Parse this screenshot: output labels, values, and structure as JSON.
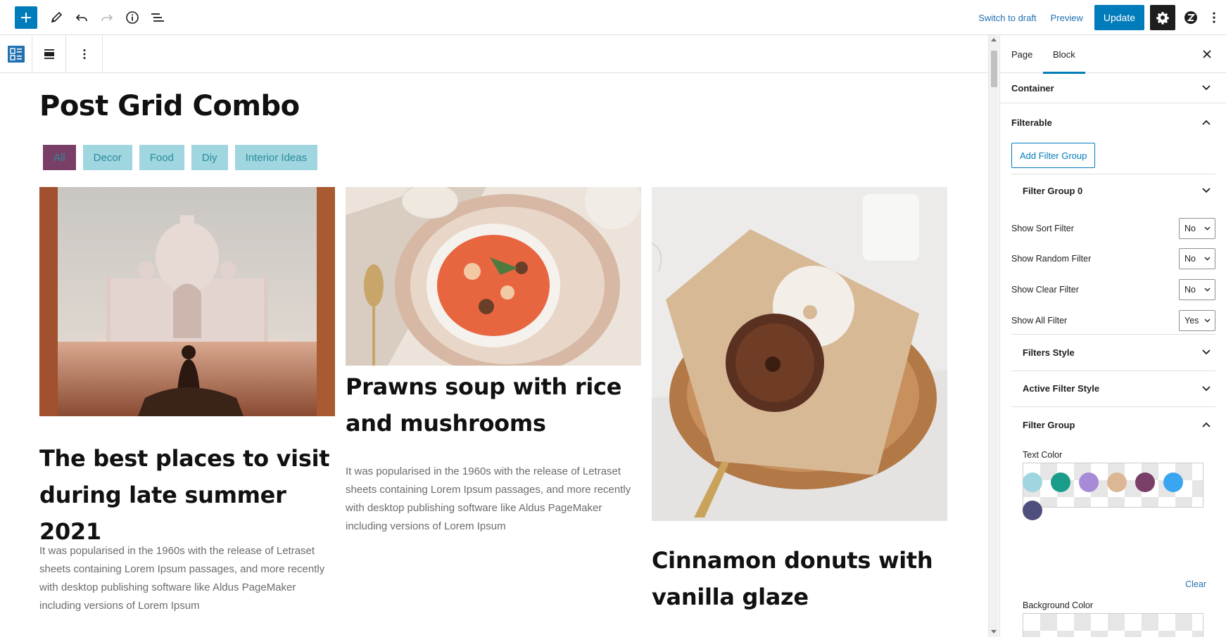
{
  "toolbar": {
    "switch_to_draft": "Switch to draft",
    "preview": "Preview",
    "update": "Update"
  },
  "page": {
    "title": "Post Grid Combo",
    "filters": [
      "All",
      "Decor",
      "Food",
      "Diy",
      "Interior Ideas"
    ],
    "active_filter": "All"
  },
  "posts": [
    {
      "title": "The best places to visit during late summer 2021",
      "excerpt": "It was popularised in the 1960s with the release of Letraset sheets containing Lorem Ipsum passages, and more recently with desktop publishing software like Aldus PageMaker including versions of Lorem Ipsum",
      "image": "taj-mahal-photo"
    },
    {
      "title": "Prawns soup with rice and mushrooms",
      "excerpt": "It was popularised in the 1960s with the release of Letraset sheets containing Lorem Ipsum passages, and more recently with desktop publishing software like Aldus PageMaker including versions of Lorem Ipsum",
      "image": "soup-bowl-photo"
    },
    {
      "title": "Cinnamon donuts with vanilla glaze",
      "image": "donuts-basket-photo"
    }
  ],
  "sidebar": {
    "tabs": [
      "Page",
      "Block"
    ],
    "active_tab": "Block",
    "panels": {
      "container": "Container",
      "filterable": "Filterable",
      "add_filter_group": "Add Filter Group",
      "filter_group_0": "Filter Group 0",
      "options": [
        {
          "label": "Show Sort Filter",
          "value": "No"
        },
        {
          "label": "Show Random Filter",
          "value": "No"
        },
        {
          "label": "Show Clear Filter",
          "value": "No"
        },
        {
          "label": "Show All Filter",
          "value": "Yes"
        }
      ],
      "filters_style": "Filters Style",
      "active_filter_style": "Active Filter Style",
      "filter_group": "Filter Group",
      "text_color": "Text Color",
      "clear": "Clear",
      "background_color": "Background Color"
    },
    "swatches": [
      "#9fd6df",
      "#1a9c8a",
      "#a88bd6",
      "#dcb796",
      "#7a3f66",
      "#3aa6f2",
      "#4f4f7d"
    ]
  },
  "colors": {
    "accent": "#007cba",
    "filter_bg": "#9fd6df",
    "filter_text": "#2a8c9c",
    "active_filter_bg": "#7a3f66"
  }
}
